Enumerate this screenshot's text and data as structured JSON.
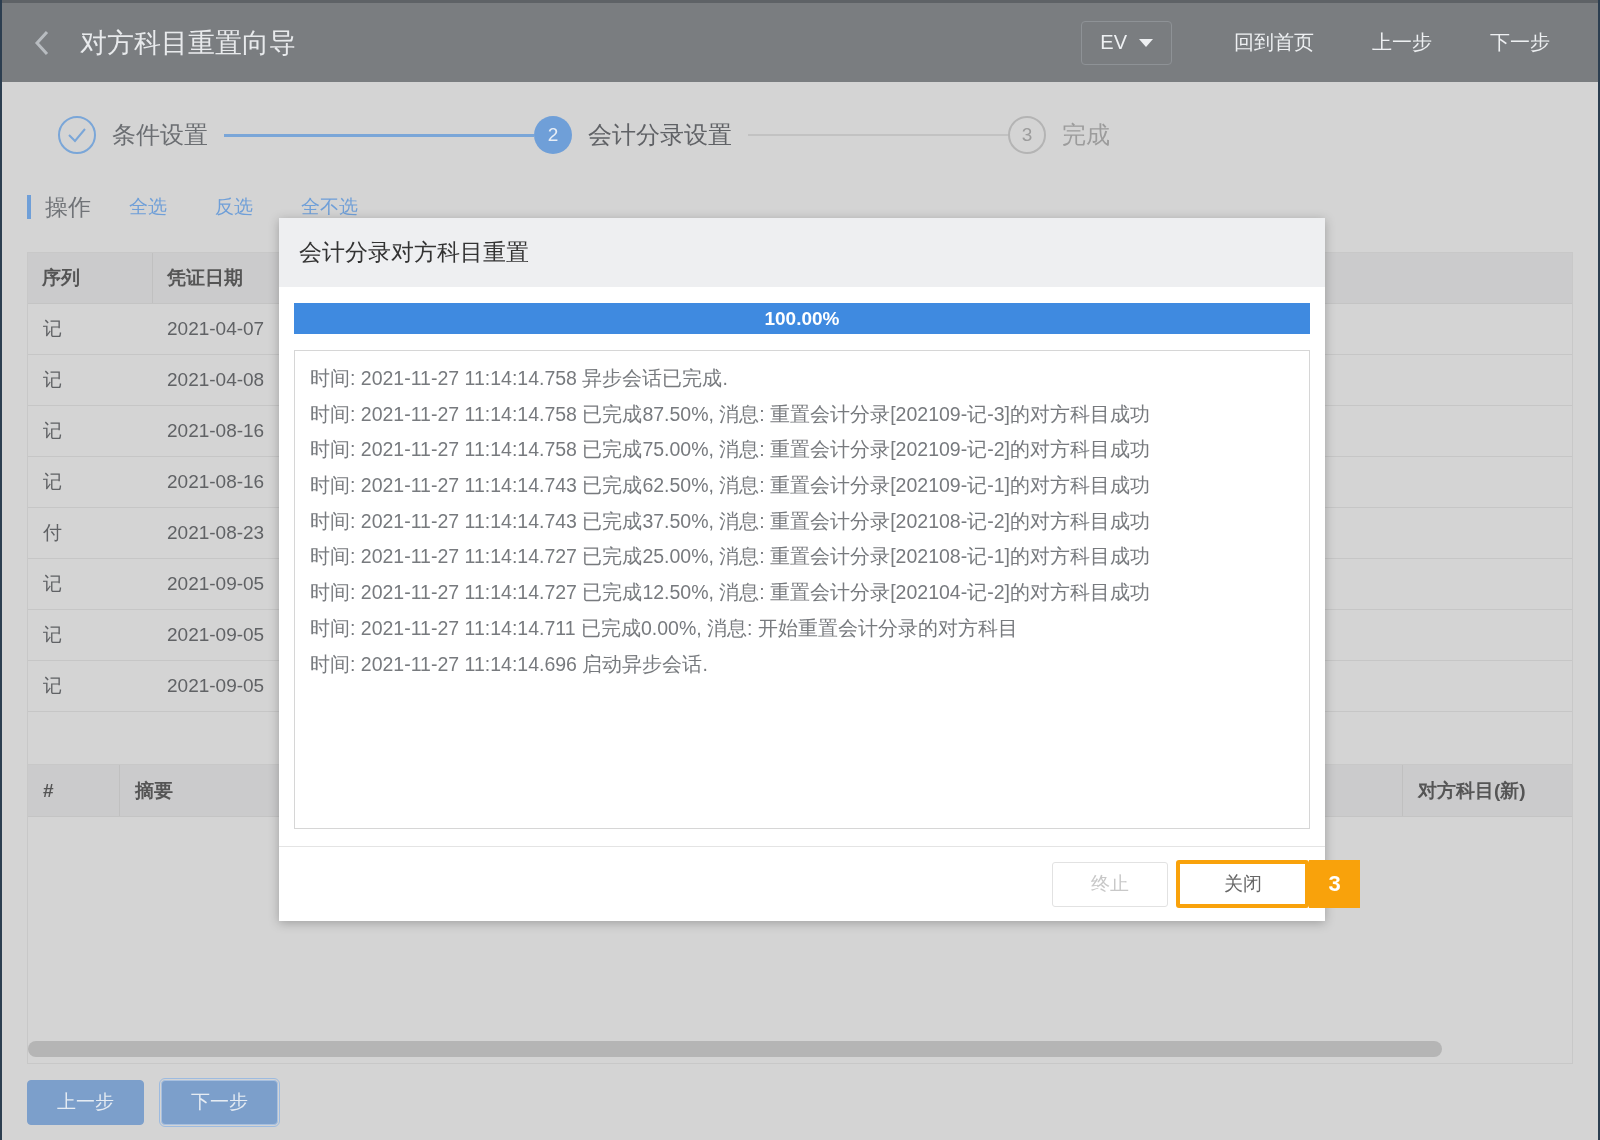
{
  "header": {
    "title": "对方科目重置向导",
    "env_select": "EV",
    "nav_links": [
      "回到首页",
      "上一步",
      "下一步"
    ]
  },
  "steps": [
    {
      "label": "条件设置",
      "completed": true,
      "active": false
    },
    {
      "label": "会计分录设置",
      "number": "2",
      "completed": false,
      "active": true
    },
    {
      "label": "完成",
      "number": "3",
      "completed": false,
      "active": false
    }
  ],
  "toolbar": {
    "label": "操作",
    "links": [
      "全选",
      "反选",
      "全不选"
    ]
  },
  "upper_table": {
    "columns": [
      "序列",
      "凭证日期"
    ],
    "rows": [
      [
        "记",
        "2021-04-07"
      ],
      [
        "记",
        "2021-04-08"
      ],
      [
        "记",
        "2021-08-16"
      ],
      [
        "记",
        "2021-08-16"
      ],
      [
        "付",
        "2021-08-23"
      ],
      [
        "记",
        "2021-09-05"
      ],
      [
        "记",
        "2021-09-05"
      ],
      [
        "记",
        "2021-09-05"
      ]
    ]
  },
  "lower_table": {
    "columns": [
      "#",
      "摘要",
      "对方科目(新)"
    ]
  },
  "dialog": {
    "title": "会计分录对方科目重置",
    "progress": {
      "level": 1,
      "label": "100.00%"
    },
    "log": [
      "时间: 2021-11-27 11:14:14.758 异步会话已完成.",
      "时间: 2021-11-27 11:14:14.758 已完成87.50%, 消息: 重置会计分录[202109-记-3]的对方科目成功",
      "时间: 2021-11-27 11:14:14.758 已完成75.00%, 消息: 重置会计分录[202109-记-2]的对方科目成功",
      "时间: 2021-11-27 11:14:14.743 已完成62.50%, 消息: 重置会计分录[202109-记-1]的对方科目成功",
      "时间: 2021-11-27 11:14:14.743 已完成37.50%, 消息: 重置会计分录[202108-记-2]的对方科目成功",
      "时间: 2021-11-27 11:14:14.727 已完成25.00%, 消息: 重置会计分录[202108-记-1]的对方科目成功",
      "时间: 2021-11-27 11:14:14.727 已完成12.50%, 消息: 重置会计分录[202104-记-2]的对方科目成功",
      "时间: 2021-11-27 11:14:14.711 已完成0.00%, 消息: 开始重置会计分录的对方科目",
      "时间: 2021-11-27 11:14:14.696 启动异步会话."
    ],
    "buttons": [
      {
        "label": "终止",
        "disabled": true,
        "highlighted": false
      },
      {
        "label": "关闭",
        "disabled": false,
        "highlighted": true
      }
    ],
    "callout": "3"
  },
  "footer_buttons": [
    {
      "label": "上一步",
      "focused": false
    },
    {
      "label": "下一步",
      "focused": true
    }
  ]
}
